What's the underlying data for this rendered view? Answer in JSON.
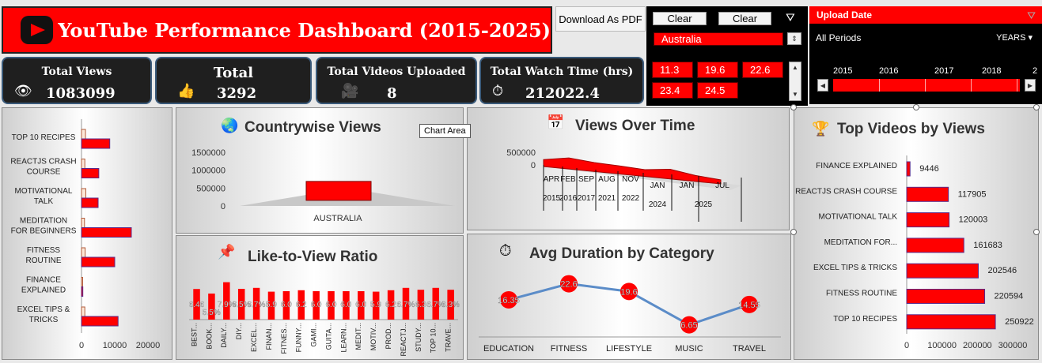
{
  "header": {
    "title": "YouTube Performance Dashboard (2015-2025)",
    "pdf_button": "Download As PDF"
  },
  "slicer": {
    "clear_label_1": "Clear",
    "clear_label_2": "Clear",
    "country_selected": "Australia",
    "duration_items": [
      "11.3",
      "19.6",
      "22.6",
      "23.4",
      "24.5"
    ]
  },
  "timeline": {
    "header": "Upload Date",
    "periods_label": "All Periods",
    "unit_label": "YEARS",
    "years": [
      "2015",
      "2016",
      "2017",
      "2018",
      "2"
    ]
  },
  "kpis": [
    {
      "label": "Total Views",
      "value": "1083099",
      "icon": "eye-icon"
    },
    {
      "label": "Total",
      "value": "3292",
      "icon": "thumbs-up-icon"
    },
    {
      "label": "Total Videos Uploaded",
      "value": "8",
      "icon": "film-camera-icon"
    },
    {
      "label": "Total Watch Time (hrs)",
      "value": "212022.4",
      "icon": "stopwatch-icon"
    }
  ],
  "colors": {
    "accent": "#ff0000",
    "dark": "#1f1f1f",
    "line": "#5b8cc8"
  },
  "tooltip": "Chart Area",
  "chart_data": [
    {
      "id": "likes-by-video",
      "type": "bar",
      "orientation": "horizontal",
      "title": "",
      "categories": [
        "TOP 10 RECIPES",
        "REACTJS CRASH COURSE",
        "MOTIVATIONAL TALK",
        "MEDITATION FOR BEGINNERS",
        "FITNESS ROUTINE",
        "FINANCE EXPLAINED",
        "EXCEL TIPS & TRICKS"
      ],
      "category_lines": [
        [
          "TOP 10 RECIPES"
        ],
        [
          "REACTJS CRASH",
          "COURSE"
        ],
        [
          "MOTIVATIONAL",
          "TALK"
        ],
        [
          "MEDITATION",
          "FOR BEGINNERS"
        ],
        [
          "FITNESS",
          "ROUTINE"
        ],
        [
          "FINANCE",
          "EXPLAINED"
        ],
        [
          "EXCEL TIPS &",
          "TRICKS"
        ]
      ],
      "series": [
        {
          "values": [
            8500,
            5200,
            5000,
            15000,
            10000,
            400,
            11000
          ]
        },
        {
          "values": [
            1200,
            1000,
            1300,
            900,
            1100,
            350,
            1000
          ]
        }
      ],
      "xlim": [
        0,
        20000
      ],
      "xticks": [
        "0",
        "10000",
        "20000"
      ]
    },
    {
      "id": "countrywise-views",
      "type": "bar",
      "title": "Countrywise Views",
      "categories": [
        "AUSTRALIA"
      ],
      "values": [
        1083099
      ],
      "ylim": [
        0,
        1500000
      ],
      "yticks": [
        "1500000",
        "1000000",
        "500000",
        "0"
      ]
    },
    {
      "id": "views-over-time",
      "type": "area",
      "title": "Views Over Time",
      "months": [
        "APR",
        "FEB",
        "SEP",
        "AUG",
        "NOV",
        "JAN",
        "JAN",
        "JUL"
      ],
      "years": [
        "2015",
        "2016",
        "2017",
        "2021",
        "2022",
        "2024",
        "2025"
      ],
      "values": [
        120000,
        260000,
        200000,
        180000,
        150000,
        250000,
        140000,
        90000
      ],
      "ylim": [
        0,
        500000
      ],
      "yticks": [
        "500000",
        "0"
      ]
    },
    {
      "id": "top-videos-by-views",
      "type": "bar",
      "orientation": "horizontal",
      "title": "Top Videos by Views",
      "categories": [
        "FINANCE EXPLAINED",
        "REACTJS CRASH COURSE",
        "MOTIVATIONAL TALK",
        "MEDITATION FOR...",
        "EXCEL TIPS & TRICKS",
        "FITNESS ROUTINE",
        "TOP 10 RECIPES"
      ],
      "values": [
        9446,
        117905,
        120003,
        161683,
        202546,
        220594,
        250922
      ],
      "labels": [
        "9446",
        "117905",
        "120003",
        "161683",
        "202546",
        "220594",
        "250922"
      ],
      "xlim": [
        0,
        300000
      ],
      "xticks": [
        "0",
        "100000",
        "200000",
        "300000"
      ]
    },
    {
      "id": "like-to-view-ratio",
      "type": "bar",
      "title": "Like-to-View Ratio",
      "categories": [
        "BEST...",
        "BOOK...",
        "DAILY...",
        "DIY...",
        "EXCEL...",
        "FINAN...",
        "FITNES...",
        "FUNNY...",
        "GAMI...",
        "GUITA...",
        "LEARN...",
        "MEDIT...",
        "MOTIV...",
        "PROD...",
        "REACTJ...",
        "STUDY...",
        "TOP 10...",
        "TRAVE..."
      ],
      "values": [
        6.46,
        5.5,
        7.9,
        6.5,
        6.7,
        5.9,
        6.0,
        6.2,
        6.0,
        6.0,
        6.0,
        6.0,
        5.9,
        6.2,
        6.7,
        6.3,
        6.7,
        6.3
      ],
      "labels": [
        "6.46",
        "5.5%",
        "7.9%",
        "6.5%",
        "6.7%",
        "5.9",
        "6.0",
        "6.2",
        "6.0",
        "6.0",
        "6.0",
        "6.0",
        "5.9",
        "6.2",
        "6.7%",
        "6.3",
        "6.7%",
        "6.3%"
      ],
      "ylim": [
        0,
        10
      ]
    },
    {
      "id": "avg-duration-by-category",
      "type": "line",
      "title": "Avg Duration by Category",
      "categories": [
        "EDUCATION",
        "FITNESS",
        "LIFESTYLE",
        "MUSIC",
        "TRAVEL"
      ],
      "values": [
        16.35,
        22.6,
        19.6,
        6.65,
        14.55
      ],
      "labels": [
        "16.35",
        "22.6",
        "19.6",
        "6.65",
        "14.55"
      ],
      "ylim": [
        0,
        30
      ]
    }
  ]
}
